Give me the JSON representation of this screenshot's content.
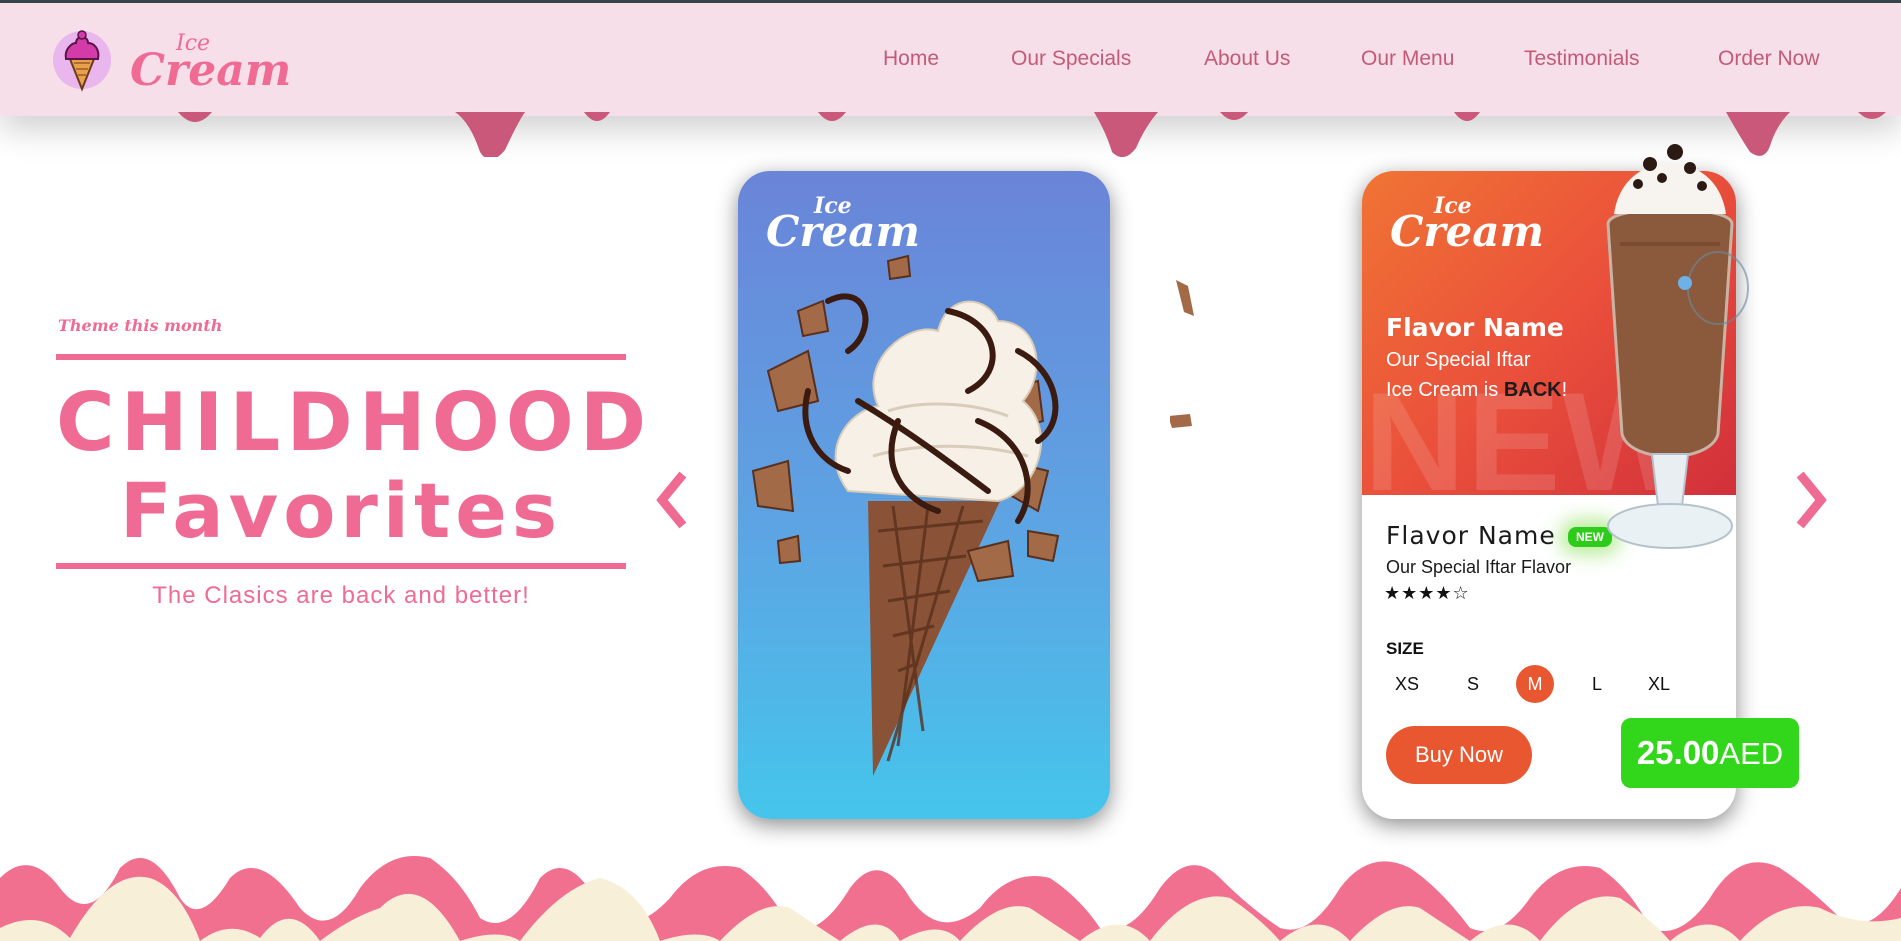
{
  "brand": {
    "ice": "Ice",
    "cream": "Cream",
    "accent": "#f06b93",
    "header_bg": "#f6dfe8"
  },
  "nav": {
    "home": "Home",
    "specials": "Our Specials",
    "about": "About Us",
    "menu": "Our Menu",
    "testimonials": "Testimonials",
    "order": "Order Now"
  },
  "hero": {
    "theme_label": "Theme this month",
    "title_line1": "CHILDHOOD",
    "title_line2": "Favorites",
    "tagline": "The Clasics are back and better!"
  },
  "card_blue": {
    "ice": "Ice",
    "cream": "Cream"
  },
  "card_product": {
    "ice": "Ice",
    "cream": "Cream",
    "promo_name": "Flavor Name",
    "promo_line1": "Our Special Iftar",
    "promo_line2_prefix": "Ice Cream is ",
    "promo_line2_bold": "BACK",
    "promo_line2_suffix": "!",
    "watermark": "NEW",
    "flavor_name": "Flavor Name",
    "badge": "NEW",
    "flavor_sub": "Our Special Iftar Flavor",
    "rating": 4,
    "rating_max": 5,
    "stars_text": "★★★★☆",
    "size_label": "SIZE",
    "sizes": [
      "XS",
      "S",
      "M",
      "L",
      "XL"
    ],
    "selected_size": "M",
    "buy_label": "Buy Now",
    "price_value": "25.00",
    "price_currency": "AED"
  },
  "icons": {
    "prev": "chevron-left-icon",
    "next": "chevron-right-icon",
    "logo": "ice-cream-cone-icon"
  }
}
